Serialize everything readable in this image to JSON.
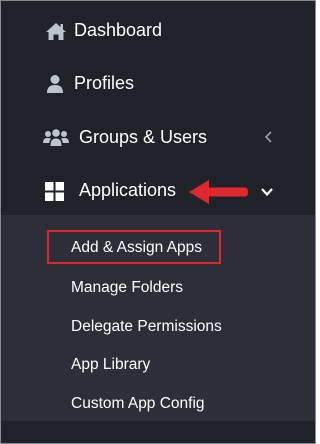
{
  "sidebar": {
    "items": [
      {
        "label": "Dashboard",
        "icon": "home-icon"
      },
      {
        "label": "Profiles",
        "icon": "user-icon"
      },
      {
        "label": "Groups & Users",
        "icon": "users-icon",
        "chevron": "chevron-left-icon"
      },
      {
        "label": "Applications",
        "icon": "grid-icon",
        "chevron": "chevron-down-icon",
        "expanded": true
      }
    ],
    "submenu": [
      {
        "label": "Add & Assign Apps",
        "highlighted": true
      },
      {
        "label": "Manage Folders"
      },
      {
        "label": "Delegate Permissions"
      },
      {
        "label": "App Library"
      },
      {
        "label": "Custom App Config"
      }
    ]
  },
  "annotation": {
    "arrow_color": "#e2262e",
    "highlight_color": "#e2262e",
    "arrow_icon": "left-arrow-icon"
  },
  "colors": {
    "sidebar_bg": "#1f2229",
    "submenu_bg": "#2c2f37",
    "text": "#ffffff",
    "accent_red": "#e2262e"
  }
}
